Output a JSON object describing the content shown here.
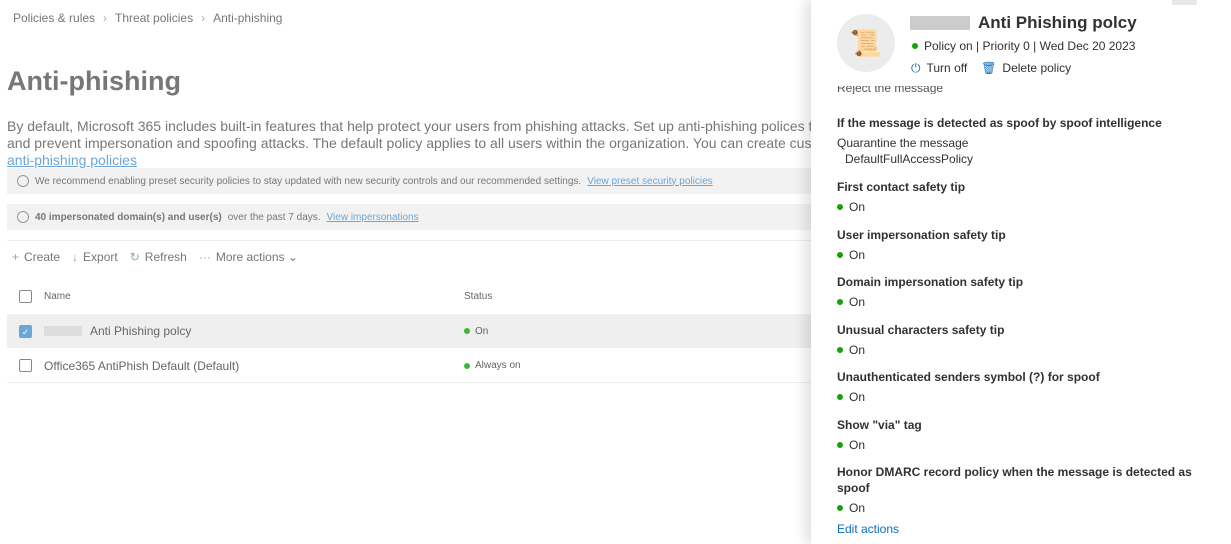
{
  "breadcrumb": [
    "Policies & rules",
    "Threat policies",
    "Anti-phishing"
  ],
  "page": {
    "title": "Anti-phishing",
    "desc1": "By default, Microsoft 365 includes built-in features that help protect your users from phishing attacks. Set up anti-phishing polices to increase",
    "desc2": "and prevent impersonation and spoofing attacks. The default policy applies to all users within the organization. You can create custom, higher",
    "desc_link": "anti-phishing policies"
  },
  "info1": {
    "text": "We recommend enabling preset security policies to stay updated with new security controls and our recommended settings.",
    "link": "View preset security policies"
  },
  "info2": {
    "bold": "40 impersonated domain(s) and user(s)",
    "text": "over the past 7 days.",
    "link": "View impersonations"
  },
  "toolbar": {
    "create": "Create",
    "export": "Export",
    "refresh": "Refresh",
    "more": "More actions"
  },
  "table": {
    "col_name": "Name",
    "col_status": "Status",
    "rows": [
      {
        "name": "Anti Phishing polcy",
        "status": "On",
        "selected": true
      },
      {
        "name": "Office365 AntiPhish Default (Default)",
        "status": "Always on",
        "selected": false
      }
    ]
  },
  "panel": {
    "title": "Anti Phishing polcy",
    "status": "Policy on | Priority 0 | Wed Dec 20 2023",
    "turn_off": "Turn off",
    "delete": "Delete policy",
    "clipped": "Reject the message",
    "spoof_heading": "If the message is detected as spoof by spoof intelligence",
    "spoof_action": "Quarantine the message",
    "spoof_policy": "DefaultFullAccessPolicy",
    "settings": [
      {
        "label": "First contact safety tip",
        "value": "On"
      },
      {
        "label": "User impersonation safety tip",
        "value": "On"
      },
      {
        "label": "Domain impersonation safety tip",
        "value": "On"
      },
      {
        "label": "Unusual characters safety tip",
        "value": "On"
      },
      {
        "label": "Unauthenticated senders symbol (?) for spoof",
        "value": "On"
      },
      {
        "label": "Show \"via\" tag",
        "value": "On"
      },
      {
        "label": "Honor DMARC record policy when the message is detected as spoof",
        "value": "On"
      }
    ],
    "edit": "Edit actions"
  },
  "colors": {
    "accent": "#0f6cbd",
    "on": "#13a10e"
  }
}
